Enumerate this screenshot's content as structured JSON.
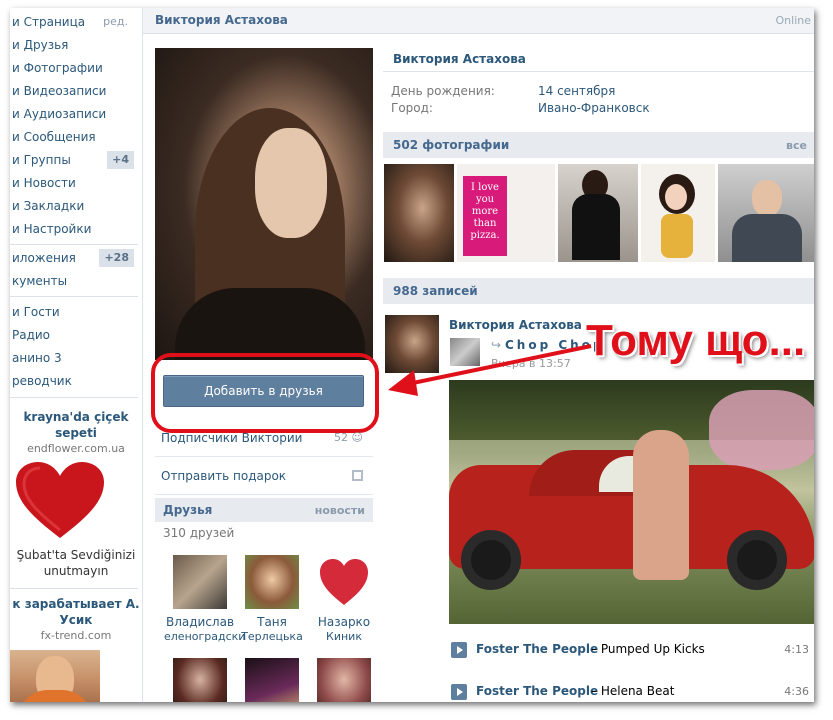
{
  "left_nav": {
    "items": [
      {
        "label": "и Страница",
        "extra": "ред."
      },
      {
        "label": "и Друзья"
      },
      {
        "label": "и Фотографии"
      },
      {
        "label": "и Видеозаписи"
      },
      {
        "label": "и Аудиозаписи"
      },
      {
        "label": "и Сообщения"
      },
      {
        "label": "и Группы",
        "badge": "+4"
      },
      {
        "label": "и Новости"
      },
      {
        "label": "и Закладки"
      },
      {
        "label": "и Настройки"
      },
      {
        "label": "иложения",
        "badge": "+28"
      },
      {
        "label": "кументы"
      },
      {
        "label": "и Гости"
      },
      {
        "label": "Радио"
      },
      {
        "label": "анино 3"
      },
      {
        "label": "реводчик"
      }
    ]
  },
  "ads": [
    {
      "title": "krayna'da çiçek sepeti",
      "domain": "endflower.com.ua",
      "text": "Şubat'ta Sevdiğinizi unutmayın"
    },
    {
      "title": "к зарабатывает А. Усик",
      "domain": "fx-trend.com"
    }
  ],
  "header": {
    "name": "Виктория Астахова",
    "status": "Online"
  },
  "profile": {
    "add_friend": "Добавить в друзья",
    "subscribers": {
      "label": "Подписчики Виктории",
      "count": "52"
    },
    "gift": "Отправить подарок"
  },
  "friends": {
    "title": "Друзья",
    "news": "новости",
    "count": "310 друзей",
    "list": [
      {
        "first": "Владислав",
        "last": "еленоградски"
      },
      {
        "first": "Таня",
        "last": "Терлецька"
      },
      {
        "first": "Назарко",
        "last": "Киник"
      }
    ]
  },
  "info": {
    "name": "Виктория Астахова",
    "birthday_label": "День рождения:",
    "birthday": "14 сентября",
    "city_label": "Город:",
    "city": "Ивано-Франковск"
  },
  "photos": {
    "title": "502 фотографии",
    "all": "все",
    "note_text": "I love you more than pizza."
  },
  "wall": {
    "title": "988 записей",
    "post": {
      "author": "Виктория Астахова",
      "repost_icon": "repost-icon",
      "repost_from": "Chop Chop",
      "time": "Вчера в 13:57"
    },
    "audio": [
      {
        "artist": "Foster The People",
        "title": "Pumped Up Kicks",
        "duration": "4:13"
      },
      {
        "artist": "Foster The People",
        "title": "Helena Beat",
        "duration": "4:36"
      }
    ]
  },
  "annotation": {
    "text": "Тому що...",
    "color": "#e0101a"
  },
  "colors": {
    "link": "#2b587a",
    "header_bg": "#e7ebf0",
    "button": "#5f7f9f",
    "highlight": "#e0101a"
  }
}
